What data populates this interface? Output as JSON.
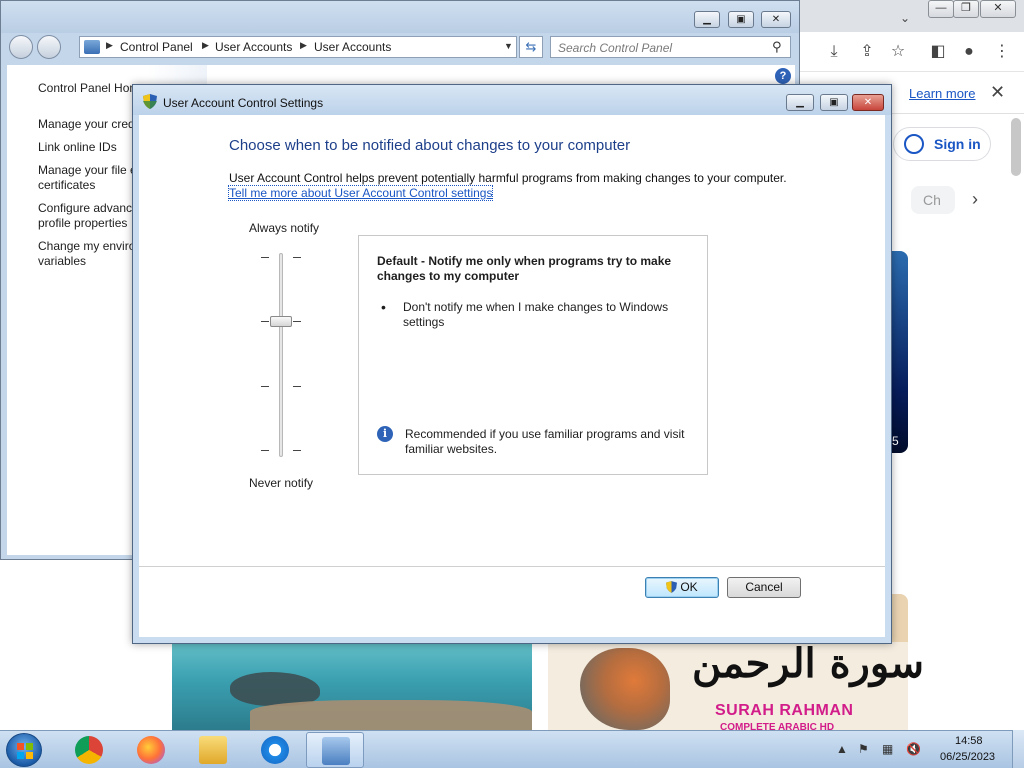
{
  "colors": {
    "uac_heading": "#1d3f8a",
    "link": "#1a56c4",
    "info_icon": "#2f63b8",
    "close_button": "#c8453b",
    "surah_text": "#d21c8a"
  },
  "chrome": {
    "learn_more": "Learn more",
    "sign_in": "Sign in",
    "chip": "Ch",
    "thumb_number": "5",
    "arabic_title": "سورة الرحمن",
    "surah_label": "SURAH RAHMAN",
    "surah_sub": "COMPLETE ARABIC HD"
  },
  "control_panel": {
    "breadcrumbs": [
      "Control Panel",
      "User Accounts",
      "User Accounts"
    ],
    "search_placeholder": "Search Control Panel",
    "sidebar": [
      "Control Panel Home",
      "Manage your credentials",
      "Link online IDs",
      "Manage your file encryption\ncertificates",
      "Configure advanced user\nprofile properties",
      "Change my environment\nvariables"
    ]
  },
  "uac": {
    "title": "User Account Control Settings",
    "heading": "Choose when to be notified about changes to your computer",
    "description": "User Account Control helps prevent potentially harmful programs from making changes to your computer.",
    "link": "Tell me more about User Account Control settings",
    "slider_top": "Always notify",
    "slider_bottom": "Never notify",
    "slider_level": 3,
    "slider_levels": 4,
    "info_title": "Default - Notify me only when programs try to make changes to my computer",
    "info_bullet": "Don't notify me when I make changes to Windows settings",
    "info_recommended": "Recommended if you use familiar programs and visit familiar websites.",
    "ok": "OK",
    "cancel": "Cancel"
  },
  "taskbar": {
    "items": [
      "chrome",
      "firefox",
      "explorer",
      "internet-explorer",
      "control-panel"
    ],
    "time": "14:58",
    "date": "06/25/2023"
  }
}
